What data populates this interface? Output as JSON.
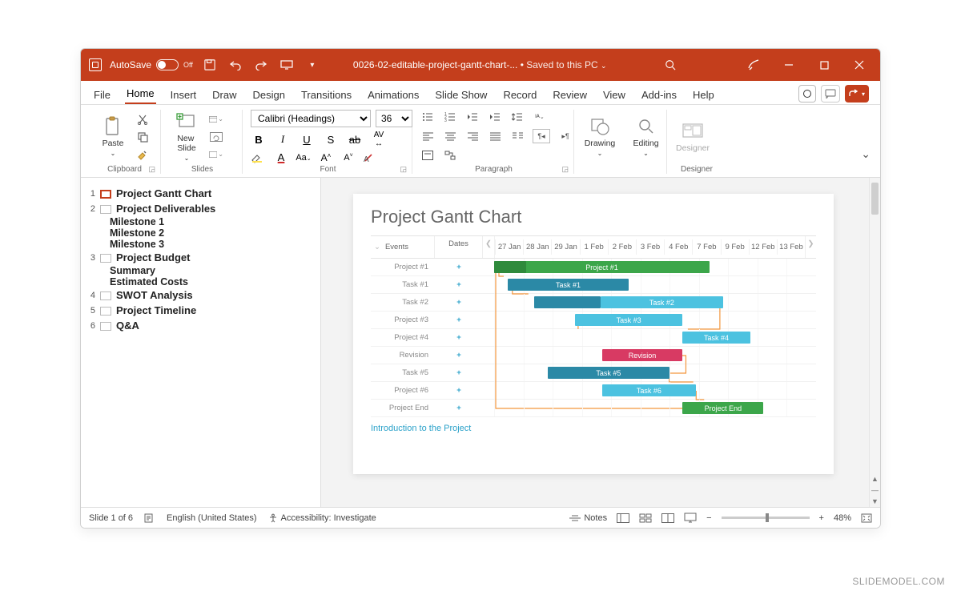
{
  "titlebar": {
    "autosave_label": "AutoSave",
    "autosave_state": "Off",
    "doc_name": "0026-02-editable-project-gantt-chart-...",
    "saved_text": "Saved to this PC"
  },
  "tabs": {
    "items": [
      "File",
      "Home",
      "Insert",
      "Draw",
      "Design",
      "Transitions",
      "Animations",
      "Slide Show",
      "Record",
      "Review",
      "View",
      "Add-ins",
      "Help"
    ],
    "active_index": 1
  },
  "ribbon": {
    "clipboard": {
      "paste": "Paste",
      "label": "Clipboard"
    },
    "slides": {
      "newslide": "New\nSlide",
      "label": "Slides"
    },
    "font": {
      "name_value": "Calibri (Headings)",
      "size_value": "36",
      "label": "Font"
    },
    "paragraph": {
      "label": "Paragraph"
    },
    "drawing": {
      "btn": "Drawing",
      "label": ""
    },
    "editing": {
      "btn": "Editing"
    },
    "designer": {
      "btn": "Designer",
      "label": "Designer"
    }
  },
  "outline": {
    "slides": [
      {
        "num": "1",
        "title": "Project Gantt Chart",
        "selected": true,
        "subs": []
      },
      {
        "num": "2",
        "title": "Project Deliverables",
        "subs": [
          "Milestone 1",
          "Milestone 2",
          "Milestone 3"
        ]
      },
      {
        "num": "3",
        "title": "Project Budget",
        "subs": [
          "Summary",
          "Estimated Costs"
        ]
      },
      {
        "num": "4",
        "title": "SWOT Analysis",
        "subs": []
      },
      {
        "num": "5",
        "title": "Project Timeline",
        "subs": []
      },
      {
        "num": "6",
        "title": "Q&A",
        "subs": []
      }
    ]
  },
  "slide": {
    "title": "Project Gantt Chart",
    "header_events": "Events",
    "header_dates": "Dates",
    "dates": [
      "27 Jan",
      "28 Jan",
      "29 Jan",
      "1 Feb",
      "2 Feb",
      "3 Feb",
      "7 Feb",
      "4 Feb",
      "9 Feb",
      "12 Feb",
      "13 Feb"
    ],
    "subtitle": "Introduction to the Project"
  },
  "chart_data": {
    "type": "gantt",
    "title": "Project Gantt Chart",
    "date_axis": [
      "27 Jan",
      "28 Jan",
      "29 Jan",
      "1 Feb",
      "2 Feb",
      "3 Feb",
      "4 Feb",
      "7 Feb",
      "9 Feb",
      "12 Feb",
      "13 Feb"
    ],
    "rows": [
      {
        "name": "Project #1",
        "label": "Project #1",
        "start": 0,
        "span": 8,
        "color": "#3ca64a",
        "progress_color": "#2f8a3c",
        "progress": 0.15
      },
      {
        "name": "Task #1",
        "label": "Task #1",
        "start": 0.5,
        "span": 4.5,
        "color": "#2b89a6"
      },
      {
        "name": "Task #2",
        "label": "Task #2",
        "start": 1.5,
        "span": 7,
        "colors": [
          "#2b89a6",
          "#4cc2e0"
        ],
        "split": 0.35
      },
      {
        "name": "Project #3",
        "label": "Task #3",
        "start": 3,
        "span": 4,
        "color": "#4cc2e0"
      },
      {
        "name": "Project #4",
        "label": "Task #4",
        "start": 7,
        "span": 2.5,
        "color": "#4cc2e0"
      },
      {
        "name": "Revision",
        "label": "Revision",
        "start": 4,
        "span": 3,
        "color": "#d83a63"
      },
      {
        "name": "Task #5",
        "label": "Task #5",
        "start": 2,
        "span": 4.5,
        "color": "#2b89a6"
      },
      {
        "name": "Project #6",
        "label": "Task #6",
        "start": 4,
        "span": 3.5,
        "color": "#4cc2e0"
      },
      {
        "name": "Project End",
        "label": "Project End",
        "start": 7,
        "span": 3,
        "color": "#3ca64a"
      }
    ]
  },
  "status": {
    "slide_info": "Slide 1 of 6",
    "language": "English (United States)",
    "accessibility": "Accessibility: Investigate",
    "notes": "Notes",
    "zoom": "48%"
  },
  "watermark": "SLIDEMODEL.COM"
}
